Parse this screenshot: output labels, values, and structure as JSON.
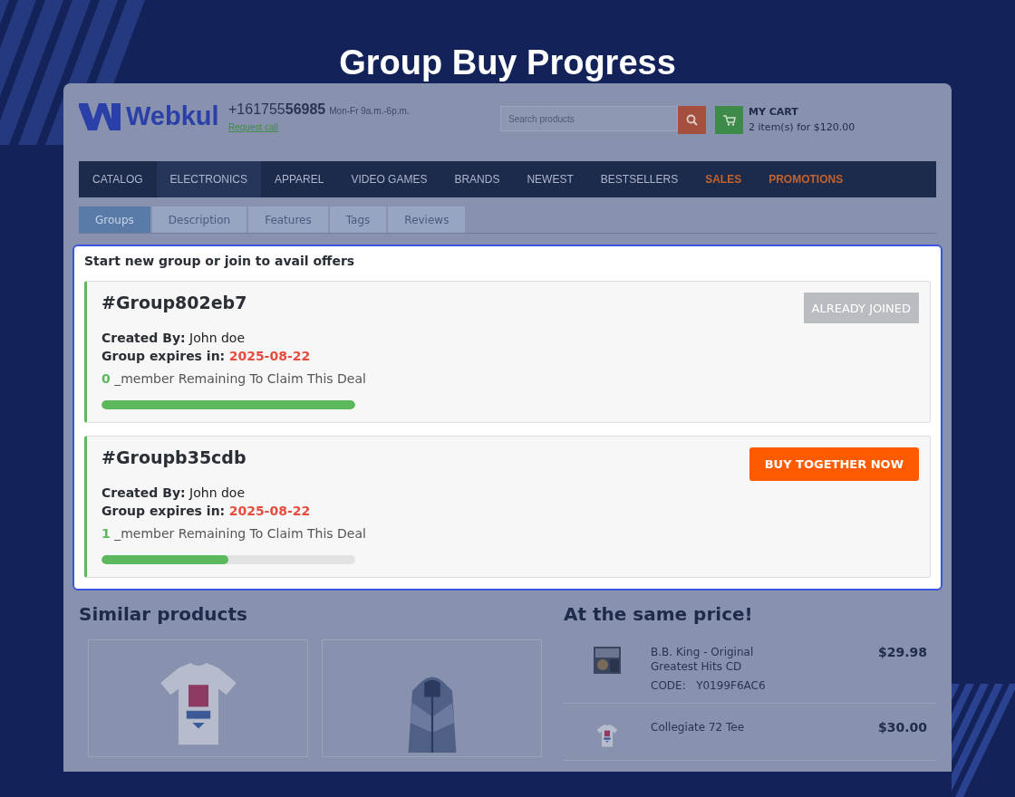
{
  "title": "Group Buy Progress",
  "store": {
    "logo": "Webkul",
    "phone_prefix": "+161755",
    "phone_bold": "56985",
    "hours": "Mon-Fr 9a.m.-6p.m.",
    "request_call": "Request call",
    "search": {
      "placeholder": "Search products"
    },
    "cart": {
      "title": "MY CART",
      "summary": "2 item(s) for $120.00"
    }
  },
  "nav": [
    {
      "label": "CATALOG",
      "selected": false,
      "kind": "normal"
    },
    {
      "label": "ELECTRONICS",
      "selected": true,
      "kind": "normal"
    },
    {
      "label": "APPAREL",
      "selected": false,
      "kind": "normal"
    },
    {
      "label": "VIDEO GAMES",
      "selected": false,
      "kind": "normal"
    },
    {
      "label": "BRANDS",
      "selected": false,
      "kind": "normal"
    },
    {
      "label": "NEWEST",
      "selected": false,
      "kind": "normal"
    },
    {
      "label": "BESTSELLERS",
      "selected": false,
      "kind": "normal"
    },
    {
      "label": "SALES",
      "selected": false,
      "kind": "highlight"
    },
    {
      "label": "PROMOTIONS",
      "selected": false,
      "kind": "highlight"
    }
  ],
  "tabs": [
    {
      "label": "Groups",
      "selected": true
    },
    {
      "label": "Description",
      "selected": false
    },
    {
      "label": "Features",
      "selected": false
    },
    {
      "label": "Tags",
      "selected": false
    },
    {
      "label": "Reviews",
      "selected": false
    }
  ],
  "groups_panel": {
    "heading": "Start new group or join to avail offers",
    "groups": [
      {
        "name": "#Group802eb7",
        "created_by_label": "Created By:",
        "created_by": "John doe",
        "expires_label": "Group expires in:",
        "expires": "2025-08-22",
        "remaining": "0",
        "remaining_text": "_member Remaining To Claim This Deal",
        "level": 1,
        "action": {
          "label": "ALREADY JOINED",
          "disabled": true
        }
      },
      {
        "name": "#Groupb35cdb",
        "created_by_label": "Created By:",
        "created_by": "John doe",
        "expires_label": "Group expires in:",
        "expires": "2025-08-22",
        "remaining": "1",
        "remaining_text": "_member Remaining To Claim This Deal",
        "level": 0.5,
        "action": {
          "label": "BUY TOGETHER NOW",
          "disabled": false
        }
      }
    ]
  },
  "similar_products": {
    "heading": "Similar products",
    "items": [
      {
        "kind": "tshirt"
      },
      {
        "kind": "jacket"
      }
    ]
  },
  "same_price": {
    "heading": "At the same price!",
    "items": [
      {
        "kind": "cd",
        "name": "B.B. King - Original Greatest Hits CD",
        "code_label": "CODE:",
        "code": "Y0199F6AC6",
        "price": "$29.98"
      },
      {
        "kind": "tshirt",
        "name": "Collegiate 72 Tee",
        "price": "$30.00"
      }
    ]
  }
}
